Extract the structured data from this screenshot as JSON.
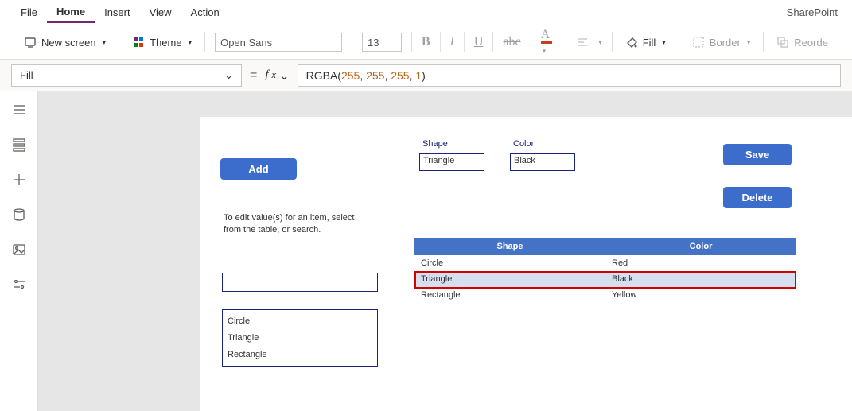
{
  "brand": "SharePoint",
  "menu": {
    "file": "File",
    "home": "Home",
    "insert": "Insert",
    "view": "View",
    "action": "Action"
  },
  "ribbon": {
    "new_screen": "New screen",
    "theme": "Theme",
    "font_name": "Open Sans",
    "font_size": "13",
    "fill": "Fill",
    "border": "Border",
    "reorder": "Reorde"
  },
  "formula": {
    "property": "Fill",
    "fn": "RGBA",
    "args": [
      "255",
      "255",
      "255",
      "1"
    ]
  },
  "app": {
    "buttons": {
      "add": "Add",
      "save": "Save",
      "delete": "Delete"
    },
    "fields": {
      "shape_label": "Shape",
      "shape_value": "Triangle",
      "color_label": "Color",
      "color_value": "Black"
    },
    "hint": "To edit value(s) for an item, select from the table, or search.",
    "list": [
      "Circle",
      "Triangle",
      "Rectangle"
    ],
    "table": {
      "headers": {
        "shape": "Shape",
        "color": "Color"
      },
      "rows": [
        {
          "shape": "Circle",
          "color": "Red",
          "selected": false
        },
        {
          "shape": "Triangle",
          "color": "Black",
          "selected": true
        },
        {
          "shape": "Rectangle",
          "color": "Yellow",
          "selected": false
        }
      ]
    }
  }
}
